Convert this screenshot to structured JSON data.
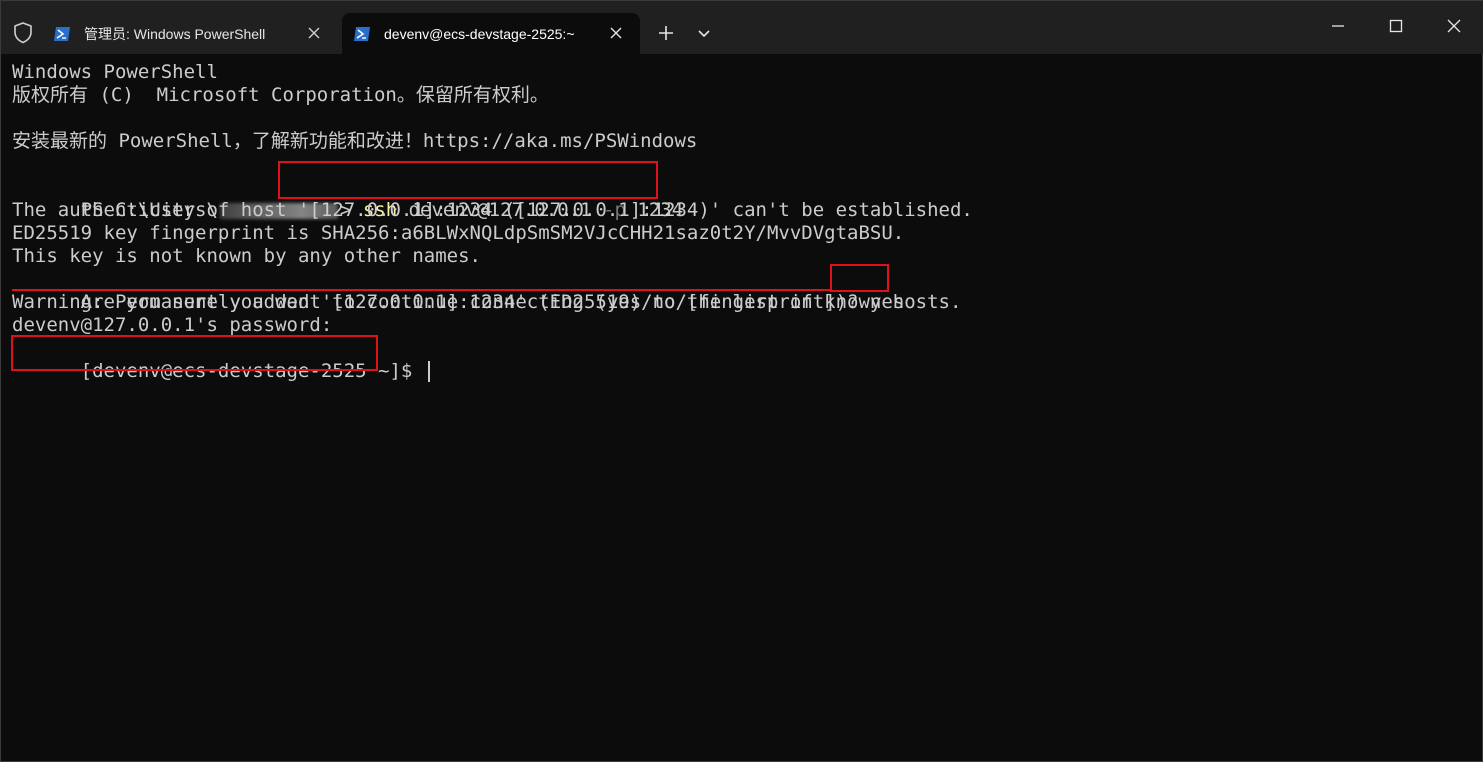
{
  "tabs": [
    {
      "title": "管理员: Windows PowerShell",
      "active": false
    },
    {
      "title": "devenv@ecs-devstage-2525:~",
      "active": true
    }
  ],
  "icons": {
    "shield": "shield-icon",
    "powershell": "powershell-icon",
    "close_tab": "close-icon",
    "new_tab": "plus-icon",
    "dropdown": "chevron-down-icon",
    "minimize": "minimize-icon",
    "maximize": "maximize-icon",
    "close_window": "close-icon"
  },
  "terminal": {
    "line1": "Windows PowerShell",
    "line2": "版权所有 (C)  Microsoft Corporation。保留所有权利。",
    "line3": "安装最新的 PowerShell，了解新功能和改进！https://aka.ms/PSWindows",
    "prompt_prefix": "PS C:\\Users\\",
    "prompt_suffix": "> ",
    "cmd_ssh": "ssh",
    "cmd_target": " devenv@127.0.0.1",
    "cmd_flag": " -p",
    "cmd_port": " 1234",
    "line5": "The authenticity of host '[127.0.0.1]:1234 ([127.0.0.1]:1234)' can't be established.",
    "line6": "ED25519 key fingerprint is SHA256:a6BLWxNQLdpSmSM2VJcCHH21saz0t2Y/MvvDVgtaBSU.",
    "line7": "This key is not known by any other names.",
    "line8_question": "Are you sure you want to continue connecting (yes/no/[fingerprint])?",
    "line8_answer": " yes",
    "line9": "Warning: Permanently added '[127.0.0.1]:1234' (ED25519) to the list of known hosts.",
    "line10": "devenv@127.0.0.1's password:",
    "line11": "[devenv@ecs-devstage-2525 ~]$ "
  },
  "colors": {
    "background": "#0c0c0c",
    "titlebar": "#202020",
    "foreground": "#cccccc",
    "command_yellow": "#f9f1a5",
    "flag_gray": "#767676",
    "annotation_red": "#e0101a"
  }
}
